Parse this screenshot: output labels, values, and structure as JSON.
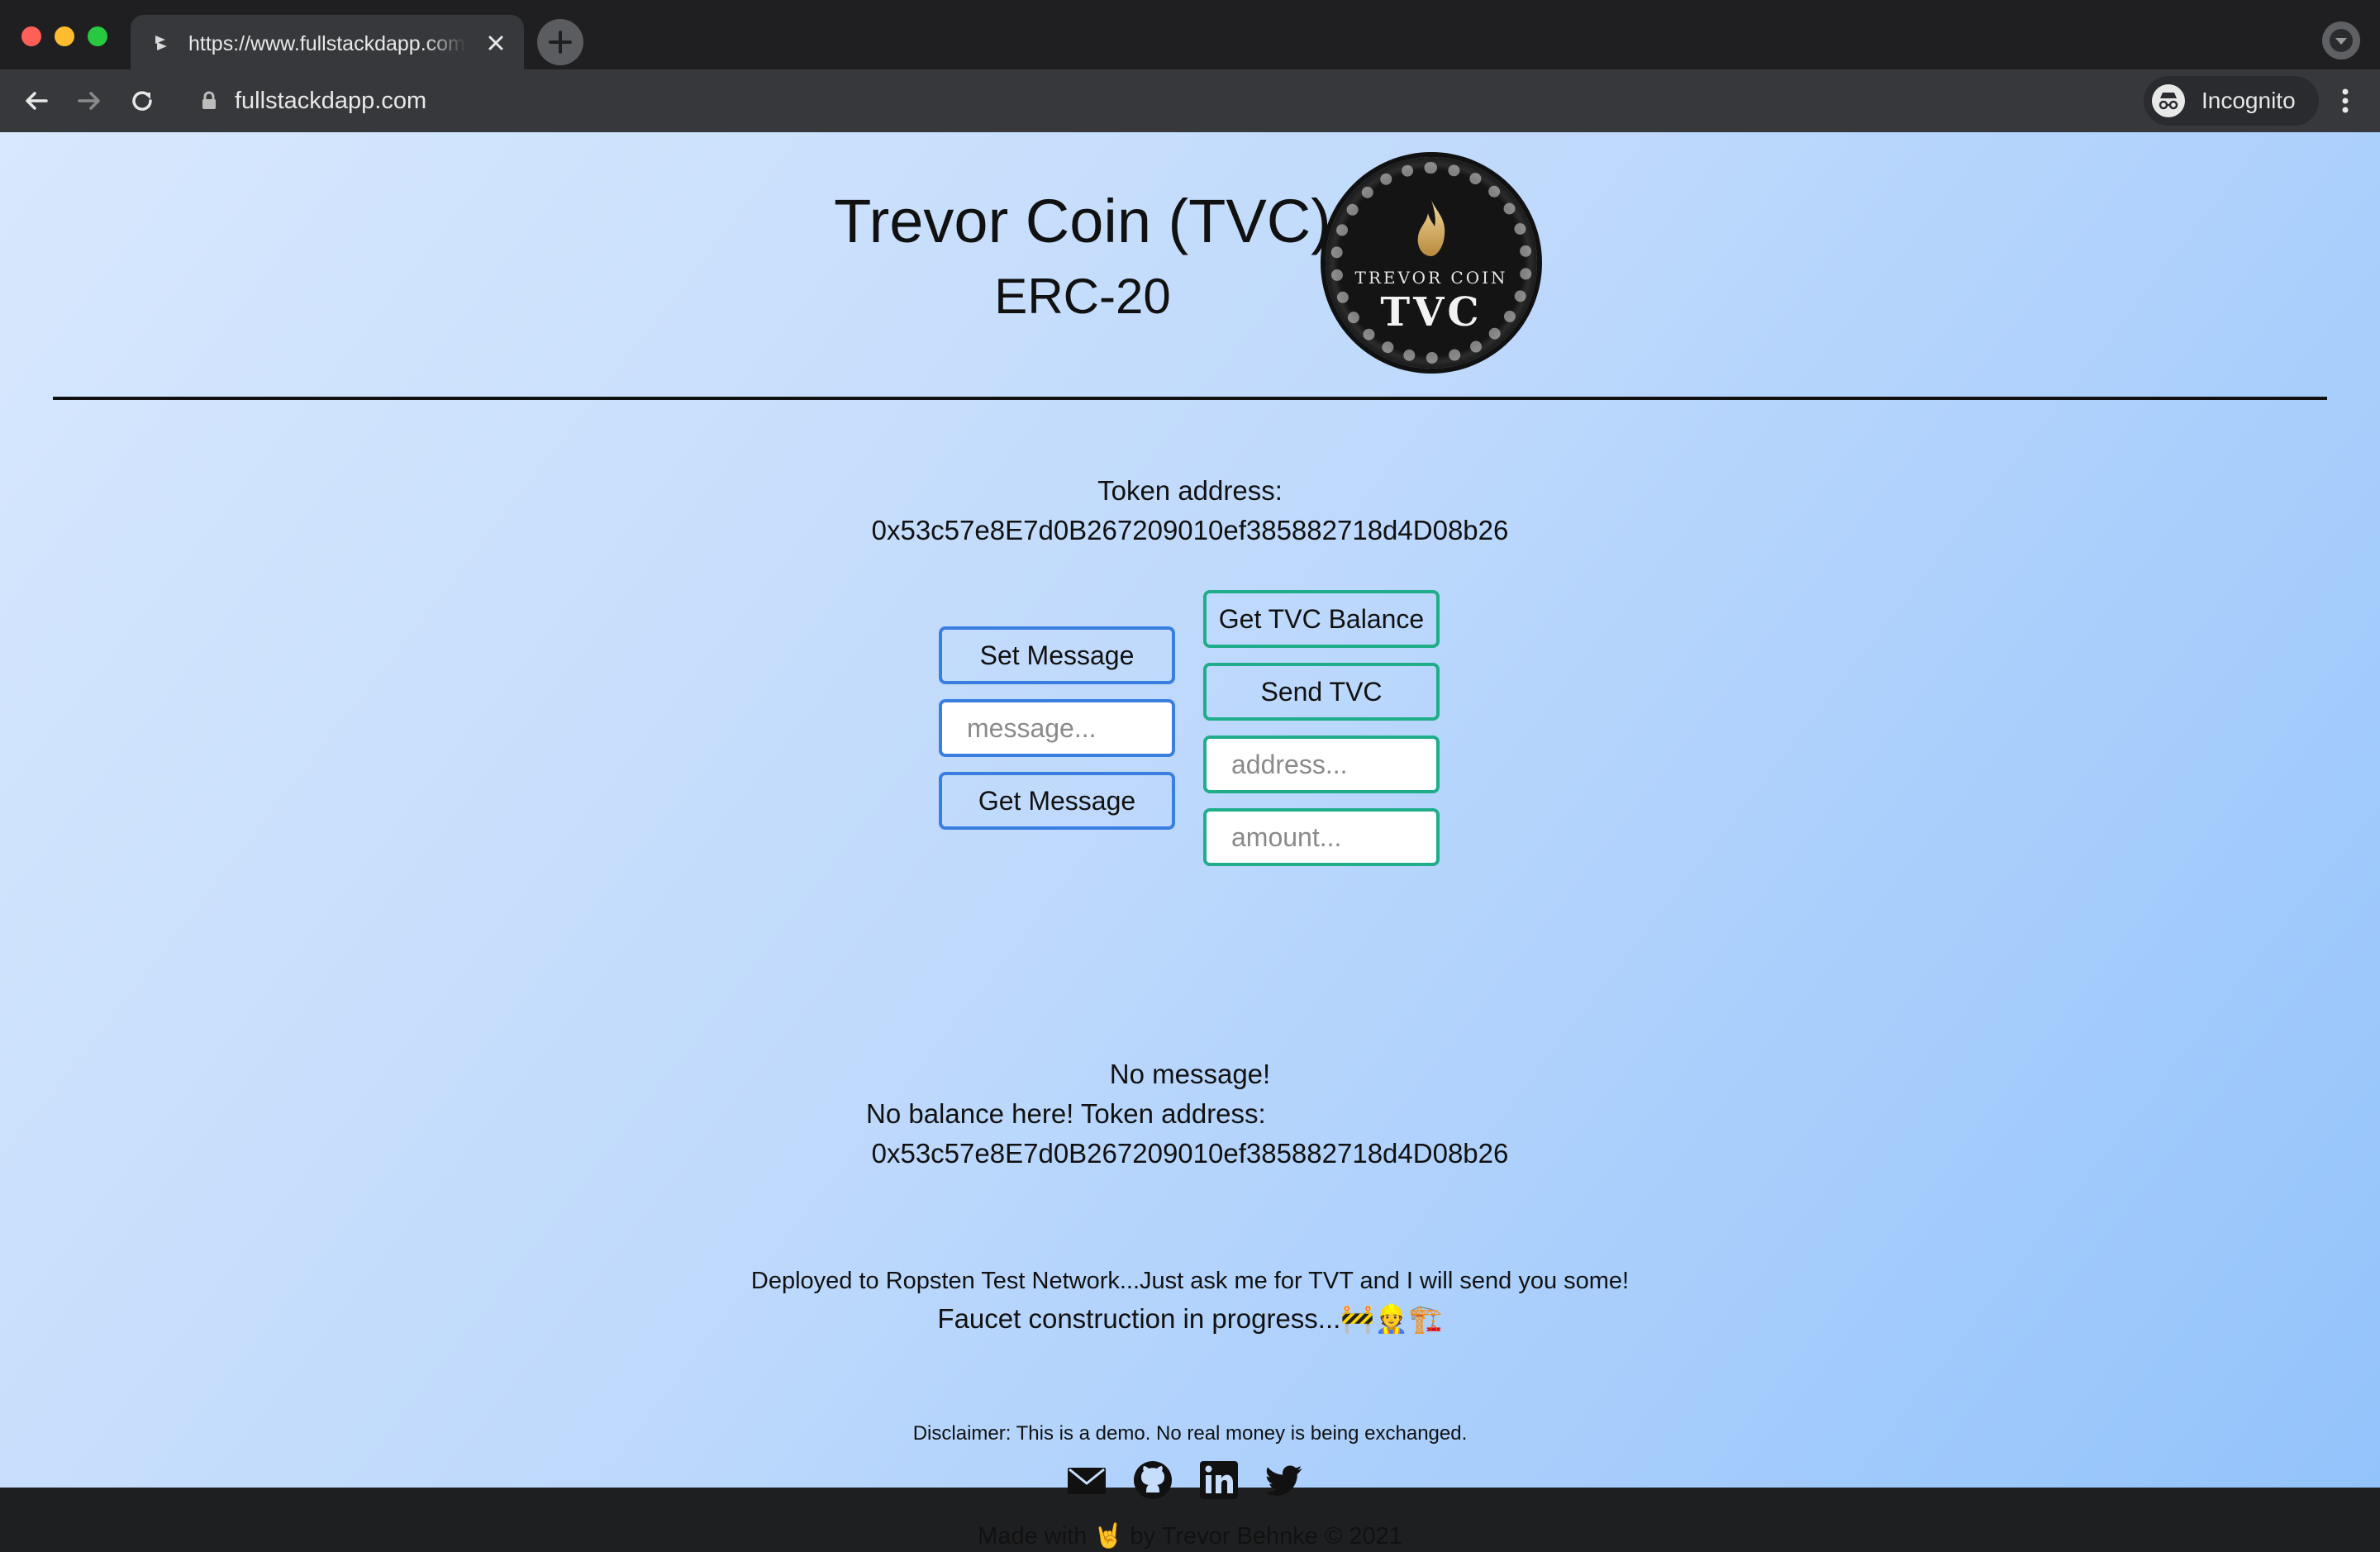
{
  "browser": {
    "tab_title": "https://www.fullstackdapp.com",
    "url": "fullstackdapp.com",
    "profile_label": "Incognito"
  },
  "header": {
    "title": "Trevor Coin (TVC)",
    "subtitle": "ERC-20",
    "logo_top_text": "TREVOR COIN",
    "logo_main_text": "TVC"
  },
  "token": {
    "label": "Token address:",
    "address": "0x53c57e8E7d0B267209010ef385882718d4D08b26"
  },
  "message_panel": {
    "set_button": "Set Message",
    "input_placeholder": "message...",
    "get_button": "Get Message"
  },
  "token_panel": {
    "balance_button": "Get TVC Balance",
    "send_button": "Send TVC",
    "address_placeholder": "address...",
    "amount_placeholder": "amount..."
  },
  "status": {
    "message": "No message!",
    "balance": "No balance here! Token address:",
    "address": "0x53c57e8E7d0B267209010ef385882718d4D08b26"
  },
  "notes": {
    "deploy": "Deployed to Ropsten Test Network...Just ask me for TVT and I will send you some!",
    "faucet": "Faucet construction in progress...🚧👷🏗️"
  },
  "footer": {
    "disclaimer": "Disclaimer: This is a demo. No real money is being exchanged.",
    "socials": [
      "mail-icon",
      "github-icon",
      "linkedin-icon",
      "twitter-icon"
    ],
    "made_with": "Made with 🤘 by Trevor Behnke  © 2021"
  },
  "colors": {
    "blue_accent": "#3a7ee0",
    "green_accent": "#1fad8a",
    "page_gradient_start": "#d8e8fd",
    "page_gradient_end": "#93c3fb"
  }
}
